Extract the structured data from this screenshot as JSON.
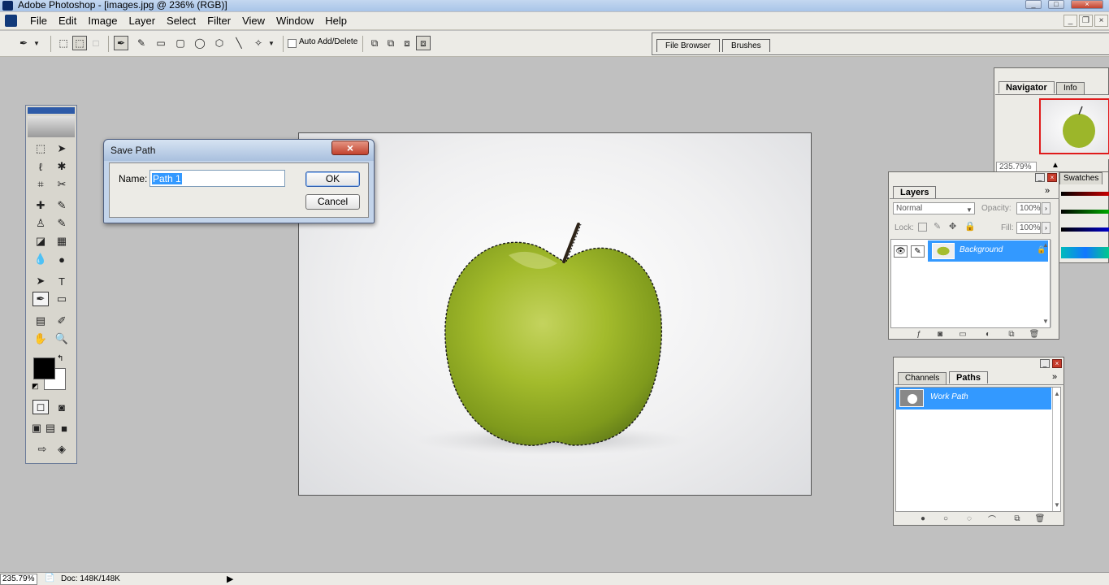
{
  "window": {
    "title": "Adobe Photoshop - [images.jpg @ 236% (RGB)]"
  },
  "menu": [
    "File",
    "Edit",
    "Image",
    "Layer",
    "Select",
    "Filter",
    "View",
    "Window",
    "Help"
  ],
  "options": {
    "auto_add_delete": "Auto Add/Delete"
  },
  "well_tabs": [
    "File Browser",
    "Brushes"
  ],
  "dialog": {
    "title": "Save Path",
    "name_label": "Name:",
    "name_value": "Path 1",
    "ok": "OK",
    "cancel": "Cancel"
  },
  "navigator": {
    "tabs": [
      "Navigator",
      "Info"
    ],
    "zoom": "235.79%",
    "swatches_tab": "Swatches"
  },
  "layers": {
    "title": "Layers",
    "blend_mode": "Normal",
    "opacity_label": "Opacity:",
    "opacity_value": "100%",
    "lock_label": "Lock:",
    "fill_label": "Fill:",
    "fill_value": "100%",
    "layer_name": "Background"
  },
  "paths": {
    "tabs": [
      "Channels",
      "Paths"
    ],
    "item": "Work Path"
  },
  "status": {
    "zoom": "235.79%",
    "doc": "Doc: 148K/148K"
  },
  "colors": {
    "selection": "#3399ff",
    "apple": "#9ab82a",
    "foreground": "#000000",
    "background": "#ffffff"
  }
}
